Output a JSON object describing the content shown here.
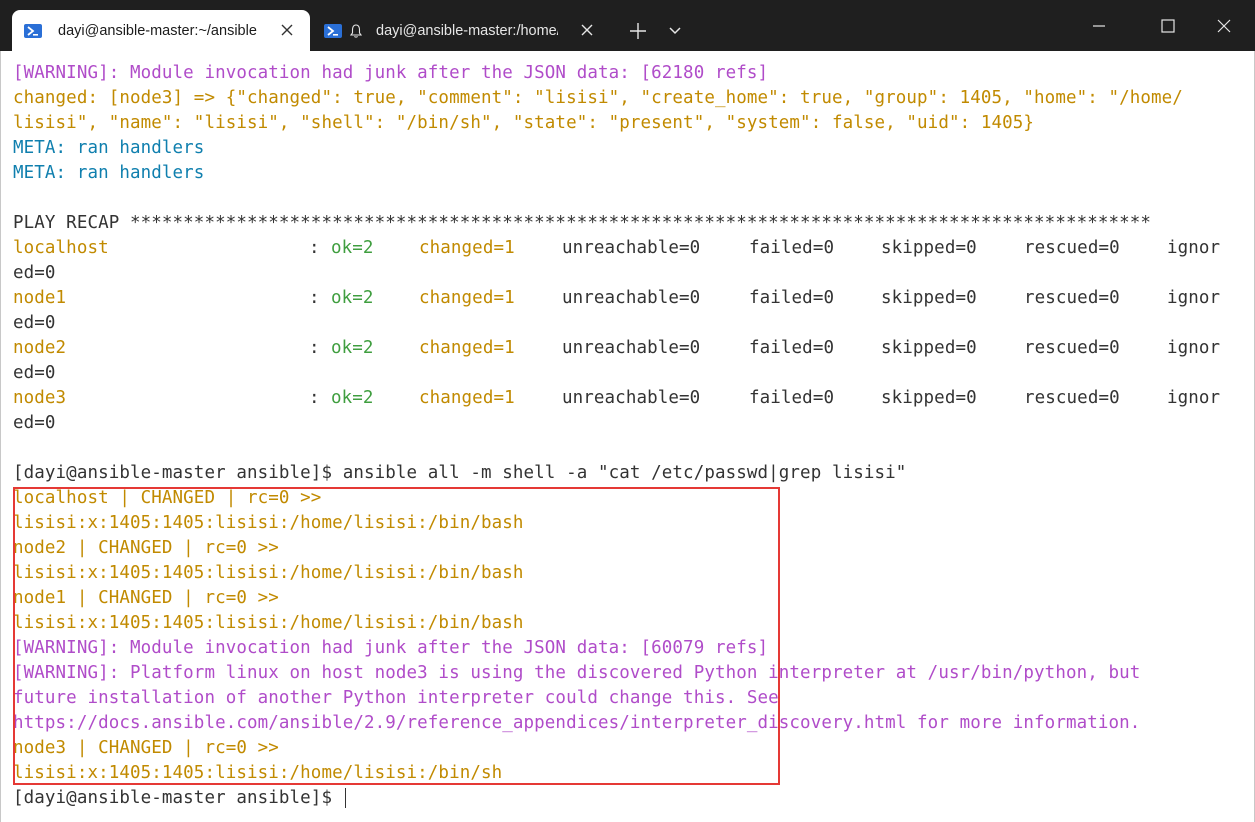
{
  "titlebar": {
    "tabs": [
      {
        "title": "dayi@ansible-master:~/ansible",
        "active": true
      },
      {
        "title": "dayi@ansible-master:/home/dayi",
        "active": false
      }
    ],
    "new_tab_glyph": "+",
    "dropdown_glyph": "⌄",
    "window_controls": [
      "minimize",
      "maximize",
      "close"
    ]
  },
  "colors": {
    "warning": "#b04cc9",
    "changed": "#c18a00",
    "meta": "#0f7fae",
    "ok": "#3f9e3f",
    "default": "#333333",
    "highlight_box": "#e53935"
  },
  "terminal": {
    "warn1": "[WARNING]: Module invocation had junk after the JSON data: [62180 refs]",
    "changed1a": "changed: [node3] => {\"changed\": true, \"comment\": \"lisisi\", \"create_home\": true, \"group\": 1405, \"home\": \"/home/",
    "changed1b": "lisisi\", \"name\": \"lisisi\", \"shell\": \"/bin/sh\", \"state\": \"present\", \"system\": false, \"uid\": 1405}",
    "meta1": "META: ran handlers",
    "meta2": "META: ran handlers",
    "recap_title": "PLAY RECAP ************************************************************************************************",
    "recap": [
      {
        "host": "localhost",
        "colon": ":",
        "ok": "ok=2",
        "changed": "changed=1",
        "unreachable": "unreachable=0",
        "failed": "failed=0",
        "skipped": "skipped=0",
        "rescued": "rescued=0",
        "ignored_a": "ignor",
        "ignored_b": "ed=0"
      },
      {
        "host": "node1",
        "colon": ":",
        "ok": "ok=2",
        "changed": "changed=1",
        "unreachable": "unreachable=0",
        "failed": "failed=0",
        "skipped": "skipped=0",
        "rescued": "rescued=0",
        "ignored_a": "ignor",
        "ignored_b": "ed=0"
      },
      {
        "host": "node2",
        "colon": ":",
        "ok": "ok=2",
        "changed": "changed=1",
        "unreachable": "unreachable=0",
        "failed": "failed=0",
        "skipped": "skipped=0",
        "rescued": "rescued=0",
        "ignored_a": "ignor",
        "ignored_b": "ed=0"
      },
      {
        "host": "node3",
        "colon": ":",
        "ok": "ok=2",
        "changed": "changed=1",
        "unreachable": "unreachable=0",
        "failed": "failed=0",
        "skipped": "skipped=0",
        "rescued": "rescued=0",
        "ignored_a": "ignor",
        "ignored_b": "ed=0"
      }
    ],
    "command": "[dayi@ansible-master ansible]$ ansible all -m shell -a \"cat /etc/passwd|grep lisisi\"",
    "out1": "localhost | CHANGED | rc=0 >>",
    "out2": "lisisi:x:1405:1405:lisisi:/home/lisisi:/bin/bash",
    "out3": "node2 | CHANGED | rc=0 >>",
    "out4": "lisisi:x:1405:1405:lisisi:/home/lisisi:/bin/bash",
    "out5": "node1 | CHANGED | rc=0 >>",
    "out6": "lisisi:x:1405:1405:lisisi:/home/lisisi:/bin/bash",
    "warn2": "[WARNING]: Module invocation had junk after the JSON data: [60079 refs]",
    "warn3": "[WARNING]: Platform linux on host node3 is using the discovered Python interpreter at /usr/bin/python, but",
    "warn4": "future installation of another Python interpreter could change this. See",
    "warn5": "https://docs.ansible.com/ansible/2.9/reference_appendices/interpreter_discovery.html for more information.",
    "out7": "node3 | CHANGED | rc=0 >>",
    "out8": "lisisi:x:1405:1405:lisisi:/home/lisisi:/bin/sh",
    "prompt": "[dayi@ansible-master ansible]$ "
  }
}
